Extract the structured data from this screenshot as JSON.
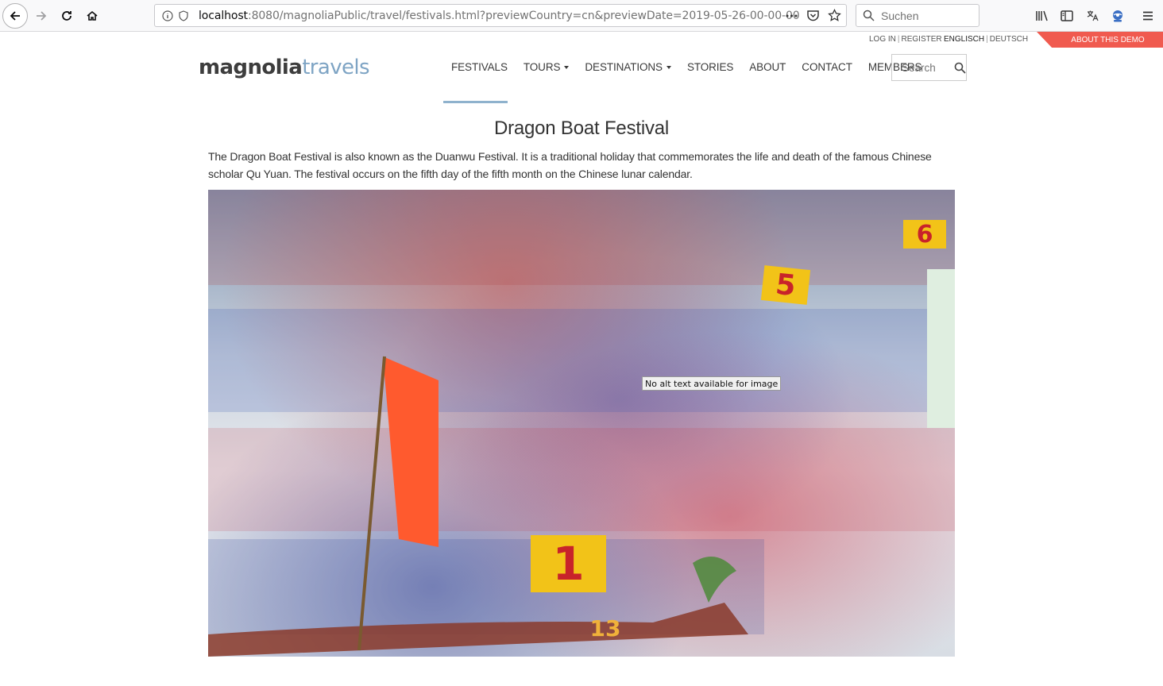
{
  "browser": {
    "url_host": "localhost",
    "url_rest": ":8080/magnoliaPublic/travel/festivals.html?previewCountry=cn&previewDate=2019-05-26-00-00-00",
    "search_placeholder": "Suchen",
    "icons": [
      "back-icon",
      "forward-icon",
      "reload-icon",
      "home-icon",
      "info-icon",
      "tracking-shield-icon",
      "more-icon",
      "pocket-icon",
      "bookmark-star-icon",
      "search-icon",
      "library-icon",
      "sidebar-icon",
      "translate-icon",
      "extension-icon",
      "menu-icon"
    ]
  },
  "utility": {
    "login": "LOG IN",
    "register": "REGISTER",
    "lang_en": "ENGLISCH",
    "lang_de": "DEUTSCH",
    "demo": "ABOUT THIS DEMO"
  },
  "logo": {
    "dark": "magnolia",
    "light": "travels"
  },
  "nav": {
    "items": [
      {
        "label": "FESTIVALS",
        "dropdown": false
      },
      {
        "label": "TOURS",
        "dropdown": true
      },
      {
        "label": "DESTINATIONS",
        "dropdown": true
      },
      {
        "label": "STORIES",
        "dropdown": false
      },
      {
        "label": "ABOUT",
        "dropdown": false
      },
      {
        "label": "CONTACT",
        "dropdown": false
      },
      {
        "label": "MEMBERS",
        "dropdown": false
      }
    ],
    "search_placeholder": "Search"
  },
  "content": {
    "title": "Dragon Boat Festival",
    "intro": "The Dragon Boat Festival is also known as the Duanwu Festival. It is a traditional holiday that commemorates the life and death of the famous Chinese scholar Qu Yuan. The festival occurs on the fifth day of the fifth month on the Chinese lunar calendar.",
    "image_tooltip": "No alt text available for image",
    "boat_numbers": [
      "1",
      "5",
      "6",
      "13"
    ],
    "colors": {
      "accent": "#8fb2cd",
      "demo_tab": "#f05a4f",
      "logo_light": "#7ea4c4"
    }
  }
}
